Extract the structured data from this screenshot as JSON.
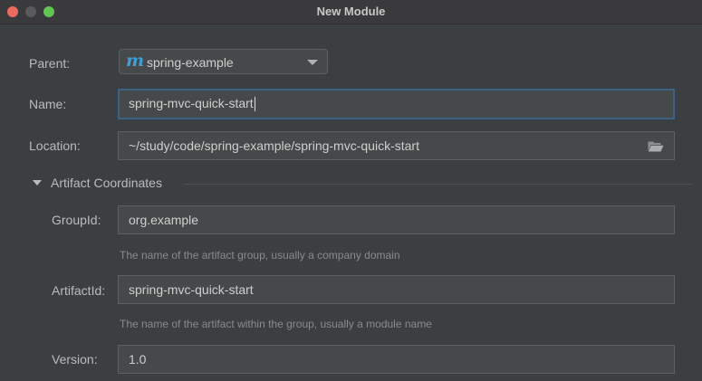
{
  "window": {
    "title": "New Module"
  },
  "form": {
    "parent": {
      "label": "Parent:",
      "value": "spring-example",
      "icon": "maven-module-icon"
    },
    "name": {
      "label": "Name:",
      "value": "spring-mvc-quick-start"
    },
    "location": {
      "label": "Location:",
      "value": "~/study/code/spring-example/spring-mvc-quick-start"
    },
    "artifact_section": {
      "title": "Artifact Coordinates",
      "expanded": true
    },
    "group_id": {
      "label": "GroupId:",
      "value": "org.example",
      "hint": "The name of the artifact group, usually a company domain"
    },
    "artifact_id": {
      "label": "ArtifactId:",
      "value": "spring-mvc-quick-start",
      "hint": "The name of the artifact within the group, usually a module name"
    },
    "version": {
      "label": "Version:",
      "value": "1.0"
    }
  },
  "colors": {
    "background": "#3c3f41",
    "field_background": "#45494a",
    "focus_border": "#3d6185",
    "maven_icon": "#3f9fd8"
  }
}
